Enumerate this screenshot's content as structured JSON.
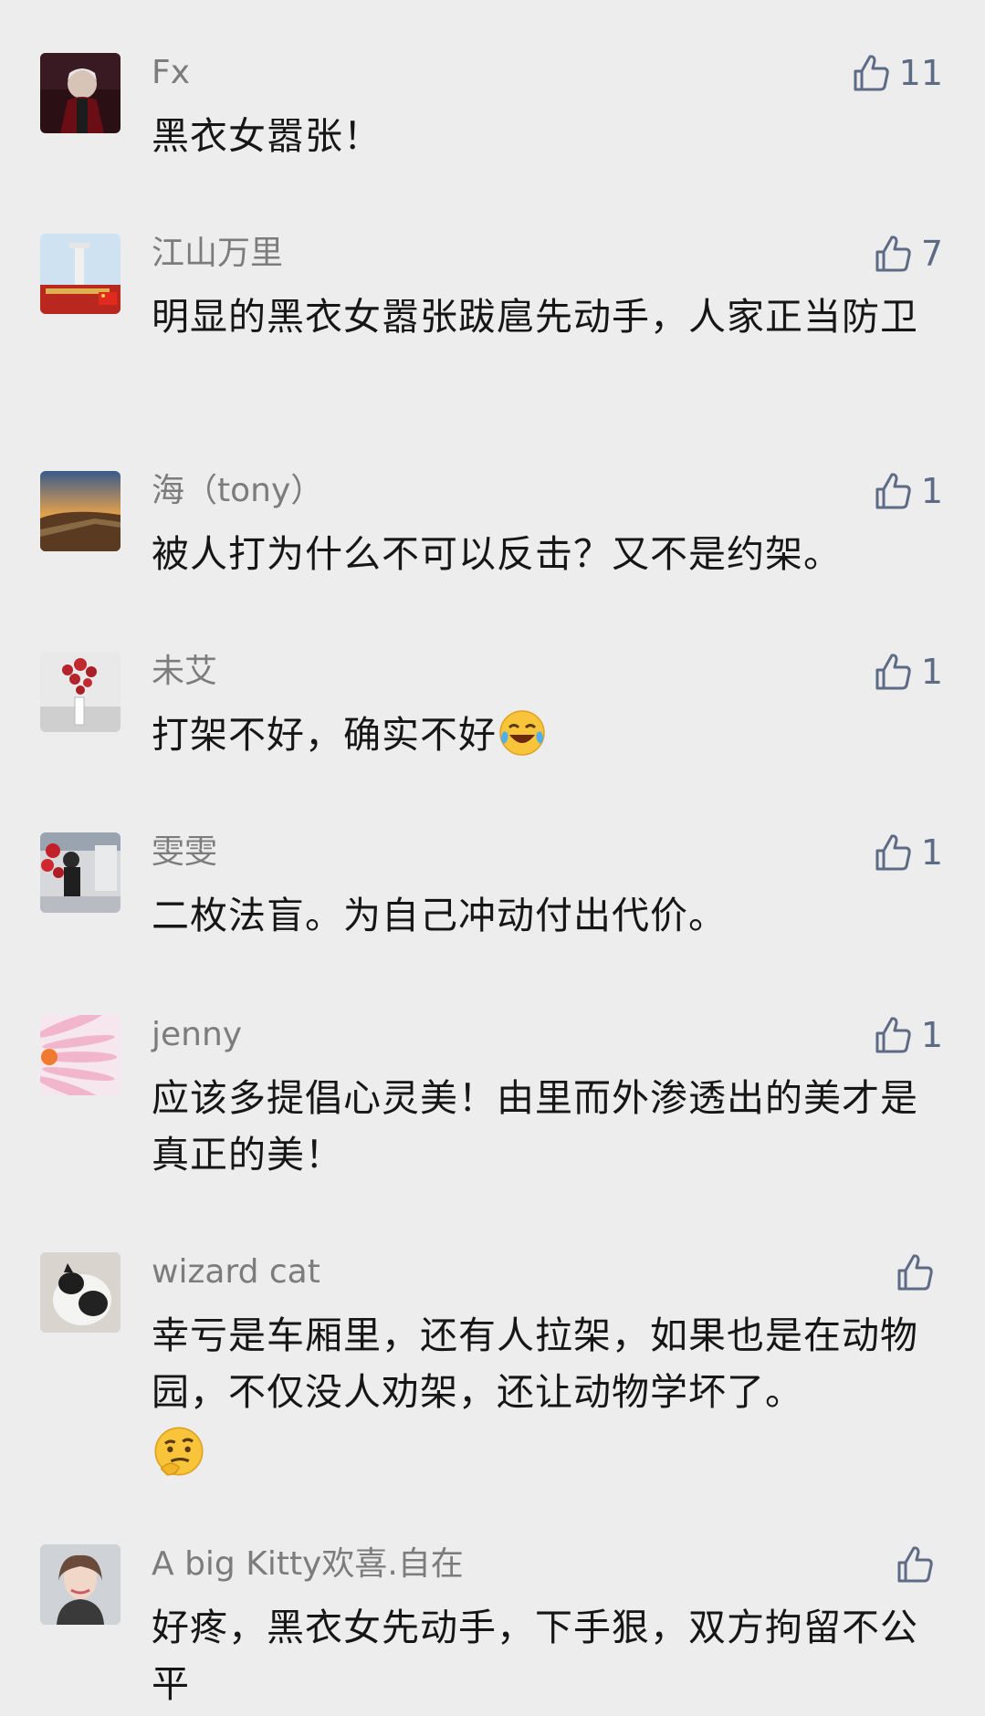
{
  "comments": [
    {
      "username": "Fx",
      "likes": "11",
      "text": "黑衣女嚣张！"
    },
    {
      "username": "江山万里",
      "likes": "7",
      "text": "明显的黑衣女嚣张跋扈先动手，人家正当防卫"
    },
    {
      "username": "海（tony）",
      "likes": "1",
      "text": "被人打为什么不可以反击？又不是约架。"
    },
    {
      "username": "未艾",
      "likes": "1",
      "text": "打架不好，确实不好",
      "emoji": "laughing-crying-emoji"
    },
    {
      "username": "雯雯",
      "likes": "1",
      "text": "二枚法盲。为自己冲动付出代价。"
    },
    {
      "username": "jenny",
      "likes": "1",
      "text": "应该多提倡心灵美！由里而外渗透出的美才是真正的美！"
    },
    {
      "username": "wizard cat",
      "likes": "",
      "text": "幸亏是车厢里，还有人拉架，如果也是在动物园，不仅没人劝架，还让动物学坏了。",
      "emoji": "thinking-face-emoji"
    },
    {
      "username": "A big Kitty欢喜.自在",
      "likes": "",
      "text": "好疼，黑衣女先动手，下手狠，双方拘留不公平"
    }
  ],
  "icons": {
    "like": "thumbs-up-outline-icon"
  },
  "colors": {
    "background": "#ededed",
    "username": "#7c7c7c",
    "like_icon": "#5d6b85"
  }
}
